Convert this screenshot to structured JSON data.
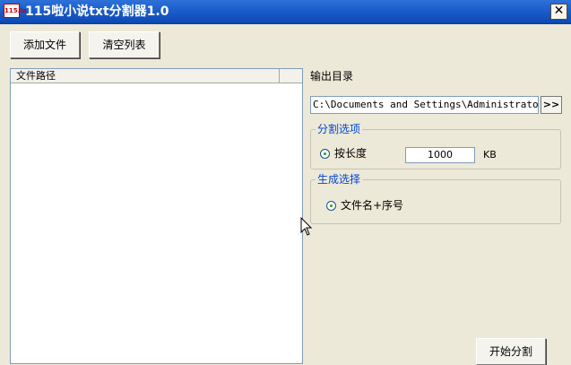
{
  "window": {
    "icon_text": "115.la",
    "title": "115啦小说txt分割器1.0",
    "close_glyph": "✕"
  },
  "toolbar": {
    "add_files_label": "添加文件",
    "clear_list_label": "清空列表"
  },
  "file_list": {
    "column_path": "文件路径",
    "items": []
  },
  "output": {
    "label": "输出目录",
    "path": "C:\\Documents and Settings\\Administrator\\桌面",
    "browse_label": ">>"
  },
  "split_options": {
    "legend": "分割选项",
    "by_length_label": "按长度",
    "length_value": "1000",
    "unit": "KB"
  },
  "naming": {
    "legend": "生成选择",
    "filename_seq_label": "文件名+序号"
  },
  "actions": {
    "start_label": "开始分割"
  },
  "colors": {
    "titlebar": "#0c48b3",
    "window_bg": "#ece9d8",
    "legend_text": "#0046d5"
  }
}
